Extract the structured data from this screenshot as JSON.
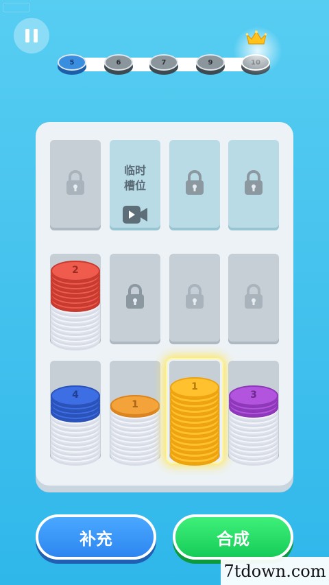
{
  "header": {
    "pause_icon": "pause-icon",
    "levels": [
      {
        "label": "5",
        "state": "current"
      },
      {
        "label": "6",
        "state": "upcoming"
      },
      {
        "label": "7",
        "state": "upcoming"
      },
      {
        "label": "9",
        "state": "upcoming"
      },
      {
        "label": "10",
        "state": "goal"
      }
    ],
    "goal_icon": "crown-icon"
  },
  "board": {
    "slots": [
      {
        "row": 1,
        "col": 1,
        "state": "locked",
        "icon": "lock-icon"
      },
      {
        "row": 1,
        "col": 2,
        "state": "temporary",
        "label": "临时\n槽位",
        "icon": "video-icon"
      },
      {
        "row": 1,
        "col": 3,
        "state": "locked",
        "icon": "lock-icon"
      },
      {
        "row": 1,
        "col": 4,
        "state": "locked",
        "icon": "lock-icon"
      },
      {
        "row": 2,
        "col": 1,
        "state": "filled",
        "top_color": "red",
        "top_value": "2",
        "top_count": 7,
        "base_count": 8
      },
      {
        "row": 2,
        "col": 2,
        "state": "locked",
        "icon": "lock-icon"
      },
      {
        "row": 2,
        "col": 3,
        "state": "locked",
        "icon": "lock-icon"
      },
      {
        "row": 2,
        "col": 4,
        "state": "locked",
        "icon": "lock-icon"
      },
      {
        "row": 3,
        "col": 1,
        "state": "filled",
        "top_color": "blue",
        "top_value": "4",
        "top_count": 4,
        "base_count": 9
      },
      {
        "row": 3,
        "col": 2,
        "state": "filled",
        "top_color": "orange",
        "top_value": "1",
        "top_count": 1,
        "base_count": 10
      },
      {
        "row": 3,
        "col": 3,
        "state": "selected",
        "top_color": "yellow",
        "top_value": "1",
        "top_count": 13,
        "base_count": 0
      },
      {
        "row": 3,
        "col": 4,
        "state": "filled",
        "top_color": "purple",
        "top_value": "3",
        "top_count": 3,
        "base_count": 10
      }
    ]
  },
  "colors": {
    "background": "#46c3ee",
    "red": "#ef5b4c",
    "blue": "#3d6ee3",
    "orange": "#f4a33a",
    "yellow": "#ffc12e",
    "purple": "#b254dd",
    "base_disc": "#f4f6fb"
  },
  "actions": {
    "refill_label": "补充",
    "merge_label": "合成"
  },
  "watermark": {
    "text": "7tdown.com"
  }
}
